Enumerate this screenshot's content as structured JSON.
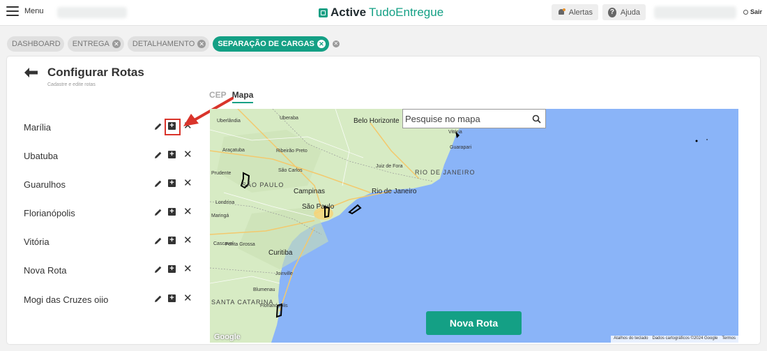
{
  "header": {
    "menu_label": "Menu",
    "brand_bold": "Active",
    "brand_rest": "TudoEntregue",
    "alerts_label": "Alertas",
    "help_label": "Ajuda",
    "logout_label": "Sair"
  },
  "breadcrumbs": [
    "DASHBOARD",
    "ENTREGA",
    "DETALHAMENTO",
    "SEPARAÇÃO DE CARGAS"
  ],
  "page": {
    "title": "Configurar Rotas",
    "subtitle": "Cadastre e edite rotas"
  },
  "tabs": [
    {
      "label": "CEP",
      "active": false
    },
    {
      "label": "Mapa",
      "active": true
    }
  ],
  "routes": [
    "Marília",
    "Ubatuba",
    "Guarulhos",
    "Florianópolis",
    "Vitória",
    "Nova Rota",
    "Mogi das Cruzes oiio"
  ],
  "map": {
    "search_placeholder": "Pesquise no mapa",
    "new_route_label": "Nova Rota",
    "logo_text": "Google",
    "attribution": [
      "Atalhos do teclado",
      "Dados cartográficos ©2024 Google",
      "Termos"
    ],
    "places": {
      "belo_horizonte": "Belo Horizonte",
      "uberaba": "Uberaba",
      "uberlandia": "Uberlândia",
      "aracatuba": "Araçatuba",
      "ribeirao_preto": "Ribeirão Preto",
      "sao_carlos": "São Carlos",
      "prudente": "Prudente",
      "sao_paulo_state": "SÃO PAULO",
      "campinas": "Campinas",
      "sao_paulo": "São Paulo",
      "londrina": "Londrina",
      "maringa": "Maringá",
      "ponta_grossa": "Ponta Grossa",
      "curitiba": "Curitiba",
      "juiz_de_fora": "Juiz de Fora",
      "rio_de_janeiro_state": "RIO DE JANEIRO",
      "rio_de_janeiro": "Rio de Janeiro",
      "vitoria": "Vitória",
      "guarapari": "Guarapari",
      "blumenau": "Blumenau",
      "santa_catarina": "SANTA CATARINA",
      "florianopolis": "Florianópolis",
      "joinville": "Joinville",
      "cascavel": "Cascavel"
    }
  },
  "colors": {
    "accent": "#14a085",
    "ocean": "#8ab4f8",
    "land": "#d7ebc4",
    "highlight": "#d9342b"
  }
}
